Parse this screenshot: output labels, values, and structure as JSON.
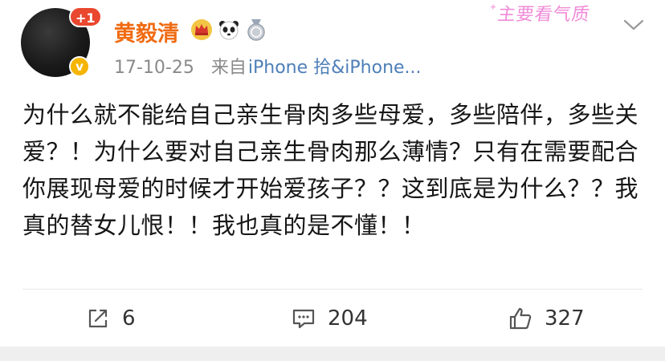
{
  "post": {
    "author": "黄毅清",
    "avatar_badge": "+1",
    "verified_mark": "v",
    "badge_icons": [
      "crown-icon",
      "panda-icon",
      "medal-icon"
    ],
    "date": "17-10-25",
    "source_prefix": "来自",
    "source": "iPhone 拾&iPhone...",
    "watermark": "主要看气质",
    "text": "为什么就不能给自己亲生骨肉多些母爱，多些陪伴，多些关爱？！为什么要对自己亲生骨肉那么薄情？只有在需要配合你展现母爱的时候才开始爱孩子？？这到底是为什么？？我真的替女儿恨！！我也真的是不懂！！"
  },
  "actions": {
    "repost_count": "6",
    "comment_count": "204",
    "like_count": "327"
  },
  "colors": {
    "username": "#f06b12",
    "source_link": "#4e7fb8",
    "badge_red": "#e9472f",
    "verified_gold": "#f5b400"
  }
}
